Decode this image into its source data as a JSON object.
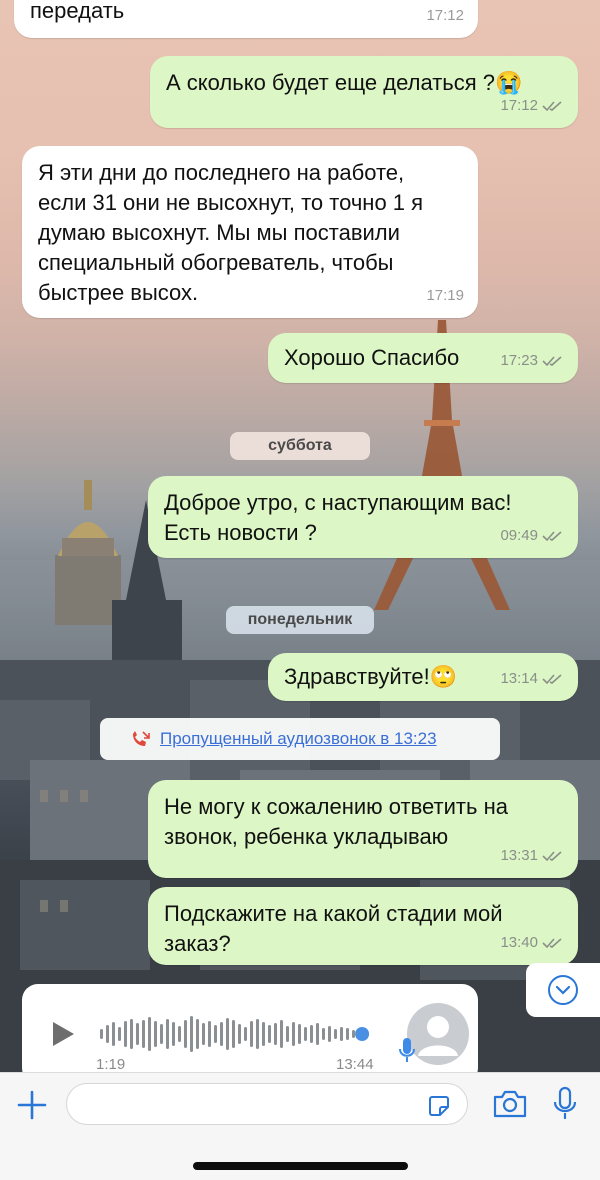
{
  "messages": [
    {
      "id": "m0",
      "direction": "in",
      "text": "передать",
      "time": "17:12"
    },
    {
      "id": "m1",
      "direction": "out",
      "text": "А сколько будет еще делаться ?😭",
      "time": "17:12",
      "status": "read"
    },
    {
      "id": "m2",
      "direction": "in",
      "text": "Я эти дни до последнего на работе,\nесли 31 они не высохнут, то точно 1 я\nдумаю высохнут. Мы мы поставили\nспециальный обогреватель, чтобы\nбыстрее высох.",
      "time": "17:19"
    },
    {
      "id": "m3",
      "direction": "out",
      "text": "Хорошо Спасибо",
      "time": "17:23",
      "status": "read"
    },
    {
      "id": "m4",
      "direction": "out",
      "text": "Доброе утро, с наступающим вас!\nЕсть новости ?",
      "time": "09:49",
      "status": "read"
    },
    {
      "id": "m5",
      "direction": "out",
      "text": "Здравствуйте!🙄",
      "time": "13:14",
      "status": "read"
    },
    {
      "id": "m6",
      "direction": "out",
      "text": "Не могу к сожалению ответить на\nзвонок, ребенка укладываю",
      "time": "13:31",
      "status": "read"
    },
    {
      "id": "m7",
      "direction": "out",
      "text": "Подскажите на какой стадии мой\nзаказ?",
      "time": "13:40",
      "status": "read"
    }
  ],
  "day_separators": {
    "saturday": "суббота",
    "monday": "понедельник"
  },
  "missed_call": {
    "text": "Пропущенный аудиозвонок в 13:23",
    "icon": "missed-call-icon"
  },
  "voice_message": {
    "duration": "1:19",
    "time": "13:44",
    "progress": 0.97,
    "icons": [
      "play-icon",
      "avatar-icon",
      "microphone-icon"
    ]
  },
  "composer": {
    "placeholder": "",
    "value": "",
    "icons": [
      "plus-icon",
      "sticker-icon",
      "camera-icon",
      "microphone-icon"
    ]
  },
  "colors": {
    "outgoing_bubble": "#dcf7c5",
    "incoming_bubble": "#ffffff",
    "accent": "#3a6fd8",
    "voice_progress": "#4a90e2"
  }
}
